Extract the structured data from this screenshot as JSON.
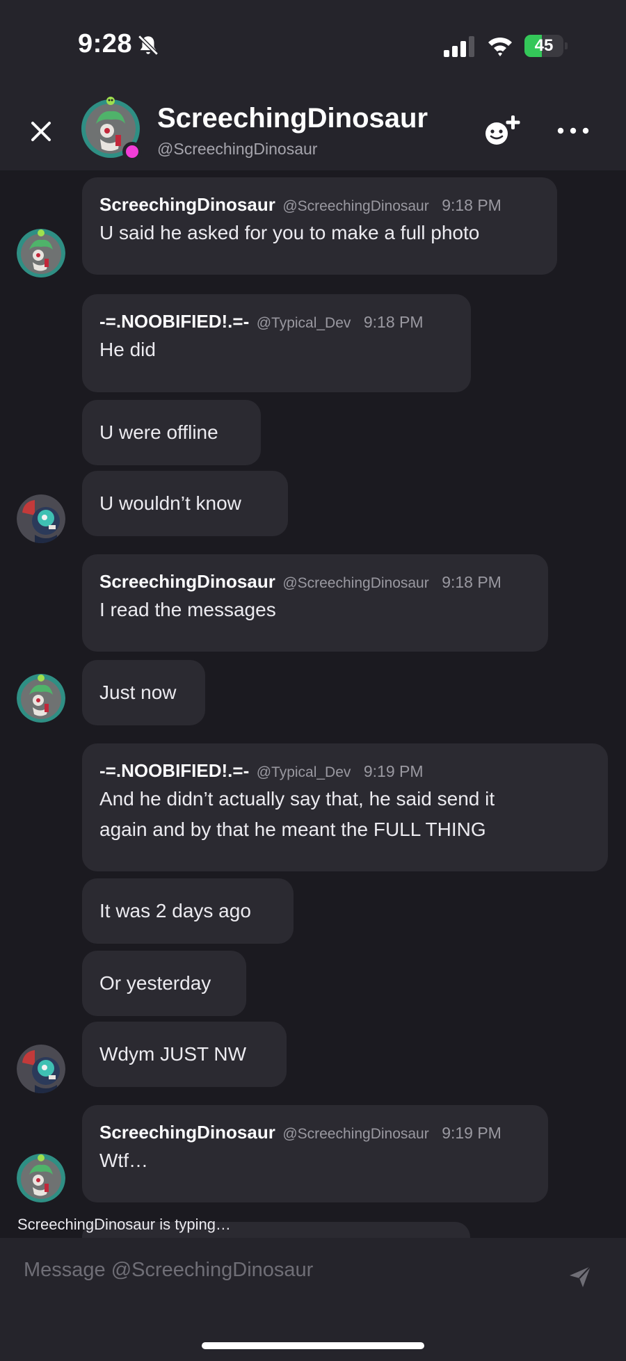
{
  "status_bar": {
    "time": "9:28",
    "battery_percent": "45"
  },
  "header": {
    "display_name": "ScreechingDinosaur",
    "handle": "@ScreechingDinosaur",
    "status_color": "#f23ed8"
  },
  "messages": [
    {
      "author": "ScreechingDinosaur",
      "handle": "@ScreechingDinosaur",
      "time": "9:18 PM",
      "text": "U said he asked for you to make a full photo"
    },
    {
      "author": "-=.NOOBIFIED!.=-",
      "handle": "@Typical_Dev",
      "time": "9:18 PM",
      "text": "He did"
    },
    {
      "text": "U were offline"
    },
    {
      "text": "U wouldn’t know"
    },
    {
      "author": "ScreechingDinosaur",
      "handle": "@ScreechingDinosaur",
      "time": "9:18 PM",
      "text": "I read the messages"
    },
    {
      "text": "Just now"
    },
    {
      "author": "-=.NOOBIFIED!.=-",
      "handle": "@Typical_Dev",
      "time": "9:19 PM",
      "text": "And he didn’t actually say that, he said send it\nagain and by that he meant the FULL THING"
    },
    {
      "text": "It was 2 days ago"
    },
    {
      "text": "Or yesterday"
    },
    {
      "text": "Wdym JUST NW"
    },
    {
      "author": "ScreechingDinosaur",
      "handle": "@ScreechingDinosaur",
      "time": "9:19 PM",
      "text": "Wtf…"
    }
  ],
  "typing_indicator": "ScreechingDinosaur is typing…",
  "composer": {
    "placeholder": "Message @ScreechingDinosaur"
  },
  "icons": {
    "close": "close-icon",
    "add_friend": "add-friend-icon",
    "more": "more-options-icon",
    "send": "send-icon",
    "bell_muted": "bell-slash-icon"
  }
}
